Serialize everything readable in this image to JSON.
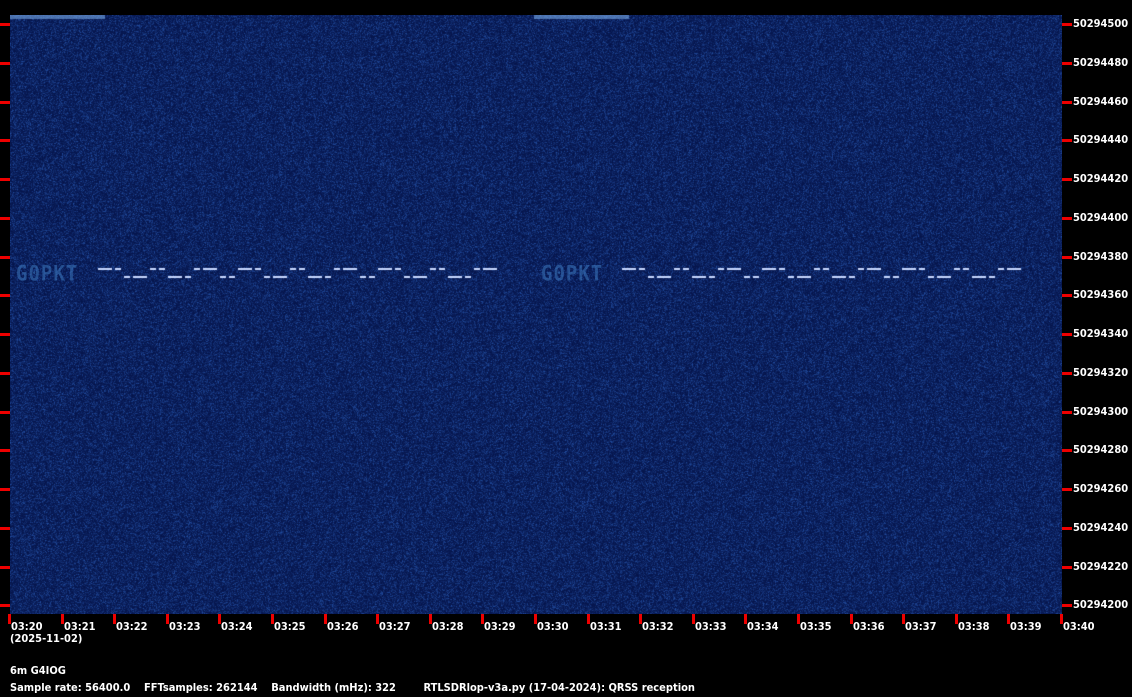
{
  "spectrogram": {
    "signal_callsign": "G0PKT",
    "background_color": "#0a1e5a",
    "signal_color": "#c8d8ff",
    "tick_color": "#e00000"
  },
  "y_axis": {
    "labels": [
      "50294500",
      "50294480",
      "50294460",
      "50294440",
      "50294420",
      "50294400",
      "50294380",
      "50294360",
      "50294340",
      "50294320",
      "50294300",
      "50294280",
      "50294260",
      "50294240",
      "50294220",
      "50294200"
    ]
  },
  "x_axis": {
    "labels": [
      "03:20",
      "03:21",
      "03:22",
      "03:23",
      "03:24",
      "03:25",
      "03:26",
      "03:27",
      "03:28",
      "03:29",
      "03:30",
      "03:31",
      "03:32",
      "03:33",
      "03:34",
      "03:35",
      "03:36",
      "03:37",
      "03:38",
      "03:39",
      "03:40"
    ],
    "date": "(2025-11-02)"
  },
  "footer": {
    "station": "6m G4IOG",
    "info": "Sample rate: 56400.0    FFTsamples: 262144    Bandwidth (mHz): 322        RTLSDRlop-v3a.py (17-04-2024): QRSS reception"
  }
}
